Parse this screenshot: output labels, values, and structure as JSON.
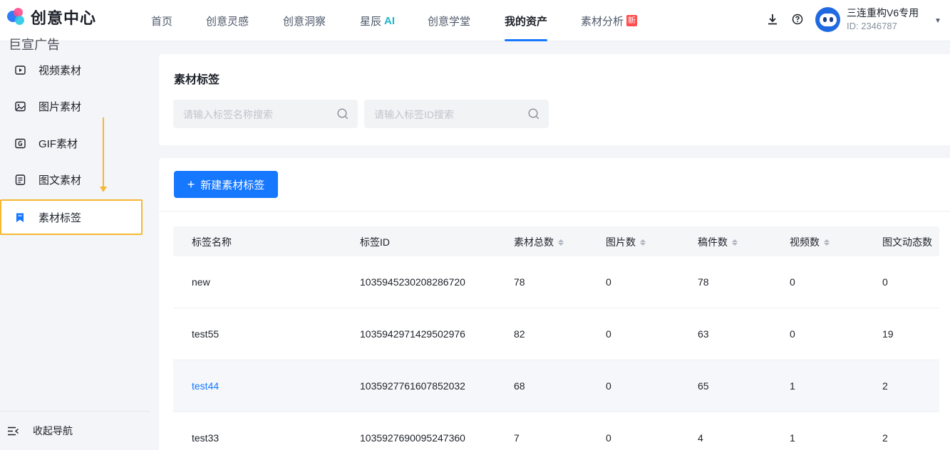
{
  "header": {
    "logo_text": "创意中心",
    "brand_sub": "巨宣广告",
    "nav": [
      {
        "label": "首页"
      },
      {
        "label": "创意灵感"
      },
      {
        "label": "创意洞察"
      },
      {
        "label": "星辰",
        "ai": "AI"
      },
      {
        "label": "创意学堂"
      },
      {
        "label": "我的资产",
        "active": true
      },
      {
        "label": "素材分析",
        "badge": "新"
      }
    ],
    "user": {
      "name": "三连重构V6专用",
      "id": "ID: 2346787"
    },
    "icons": [
      "download-icon",
      "help-icon",
      "avatar",
      "chevron-down-icon"
    ]
  },
  "sidebar": {
    "items": [
      {
        "label": "视频素材",
        "icon": "video-icon"
      },
      {
        "label": "图片素材",
        "icon": "image-icon"
      },
      {
        "label": "GIF素材",
        "icon": "gif-icon"
      },
      {
        "label": "图文素材",
        "icon": "article-icon"
      },
      {
        "label": "素材标签",
        "icon": "bookmark-icon",
        "active": true
      }
    ],
    "collapse_label": "收起导航"
  },
  "panel": {
    "title": "素材标签",
    "search_name_placeholder": "请输入标签名称搜索",
    "search_id_placeholder": "请输入标签ID搜索",
    "new_button": "新建素材标签"
  },
  "table": {
    "columns": [
      "标签名称",
      "标签ID",
      "素材总数",
      "图片数",
      "稿件数",
      "视频数",
      "图文动态数"
    ],
    "rows": [
      {
        "name": "new",
        "id": "1035945230208286720",
        "total": "78",
        "images": "0",
        "drafts": "78",
        "videos": "0",
        "posts": "0"
      },
      {
        "name": "test55",
        "id": "1035942971429502976",
        "total": "82",
        "images": "0",
        "drafts": "63",
        "videos": "0",
        "posts": "19"
      },
      {
        "name": "test44",
        "id": "1035927761607852032",
        "total": "68",
        "images": "0",
        "drafts": "65",
        "videos": "1",
        "posts": "2"
      },
      {
        "name": "test33",
        "id": "1035927690095247360",
        "total": "7",
        "images": "0",
        "drafts": "4",
        "videos": "1",
        "posts": "2"
      }
    ]
  },
  "colors": {
    "accent": "#1677ff",
    "highlight": "#f7b731",
    "badge": "#ff4d4f",
    "ai": "#1bb6c9"
  }
}
